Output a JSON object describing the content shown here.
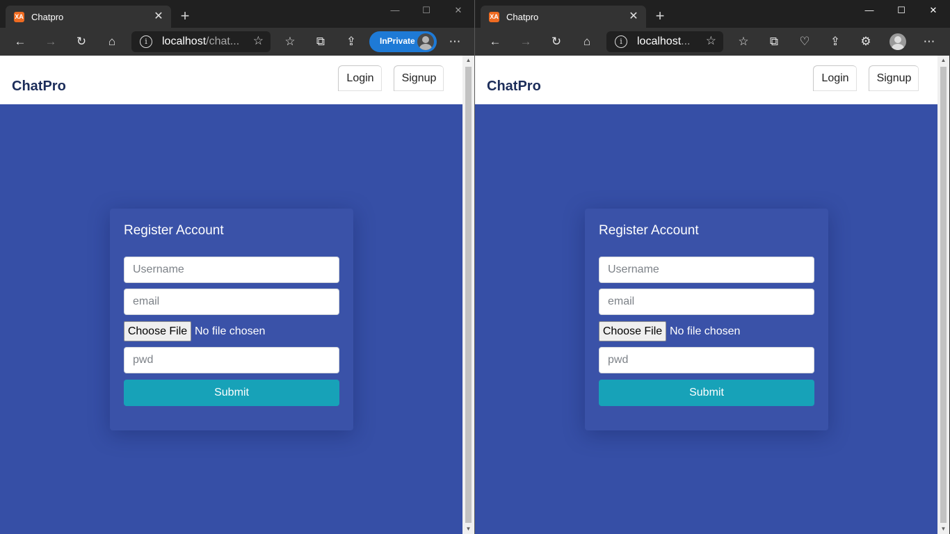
{
  "windows": [
    {
      "tab_title": "Chatpro",
      "favicon_label": "XA",
      "address": {
        "host": "localhost",
        "path": "/chat..."
      },
      "inprivate_label": "InPrivate",
      "page": {
        "brand": "ChatPro",
        "nav": {
          "login": "Login",
          "signup": "Signup"
        },
        "form": {
          "title": "Register Account",
          "username_placeholder": "Username",
          "email_placeholder": "email",
          "choose_file_label": "Choose File",
          "file_status": "No file chosen",
          "password_placeholder": "pwd",
          "submit_label": "Submit"
        }
      }
    },
    {
      "tab_title": "Chatpro",
      "favicon_label": "XA",
      "address": {
        "host": "localhost",
        "path": "..."
      },
      "page": {
        "brand": "ChatPro",
        "nav": {
          "login": "Login",
          "signup": "Signup"
        },
        "form": {
          "title": "Register Account",
          "username_placeholder": "Username",
          "email_placeholder": "email",
          "choose_file_label": "Choose File",
          "file_status": "No file chosen",
          "password_placeholder": "pwd",
          "submit_label": "Submit"
        }
      }
    }
  ],
  "icons": {
    "back": "arrow-left-icon",
    "forward": "arrow-right-icon",
    "refresh": "refresh-icon",
    "home": "home-icon",
    "favorites": "favorites-icon",
    "collections": "collections-icon",
    "share": "share-icon",
    "more": "more-icon"
  },
  "colors": {
    "page_background": "#364fa6",
    "card_background": "#3a52a8",
    "submit_button": "#17a2b8",
    "brand_text": "#1c2d5a",
    "inprivate_badge": "#1e7ad6"
  }
}
